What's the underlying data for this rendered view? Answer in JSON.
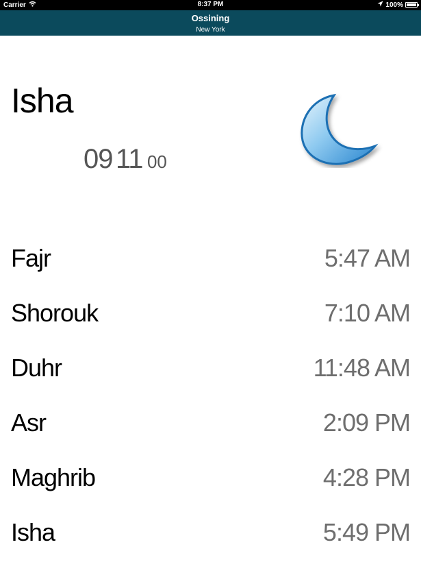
{
  "status_bar": {
    "carrier": "Carrier",
    "time": "8:37 PM",
    "battery": "100%",
    "battery_level": 1.0
  },
  "nav": {
    "title": "Ossining",
    "subtitle": "New York"
  },
  "current": {
    "prayer": "Isha",
    "hours": "09",
    "minutes": "11",
    "seconds": "00",
    "icon": "moon-icon"
  },
  "prayers": [
    {
      "name": "Fajr",
      "time": "5:47 AM"
    },
    {
      "name": "Shorouk",
      "time": "7:10 AM"
    },
    {
      "name": "Duhr",
      "time": "11:48 AM"
    },
    {
      "name": "Asr",
      "time": "2:09 PM"
    },
    {
      "name": "Maghrib",
      "time": "4:28 PM"
    },
    {
      "name": "Isha",
      "time": "5:49 PM"
    }
  ],
  "colors": {
    "nav_bg": "#0b4a5c",
    "time_text": "#6e6e6e",
    "moon": "#4aa3e0"
  }
}
